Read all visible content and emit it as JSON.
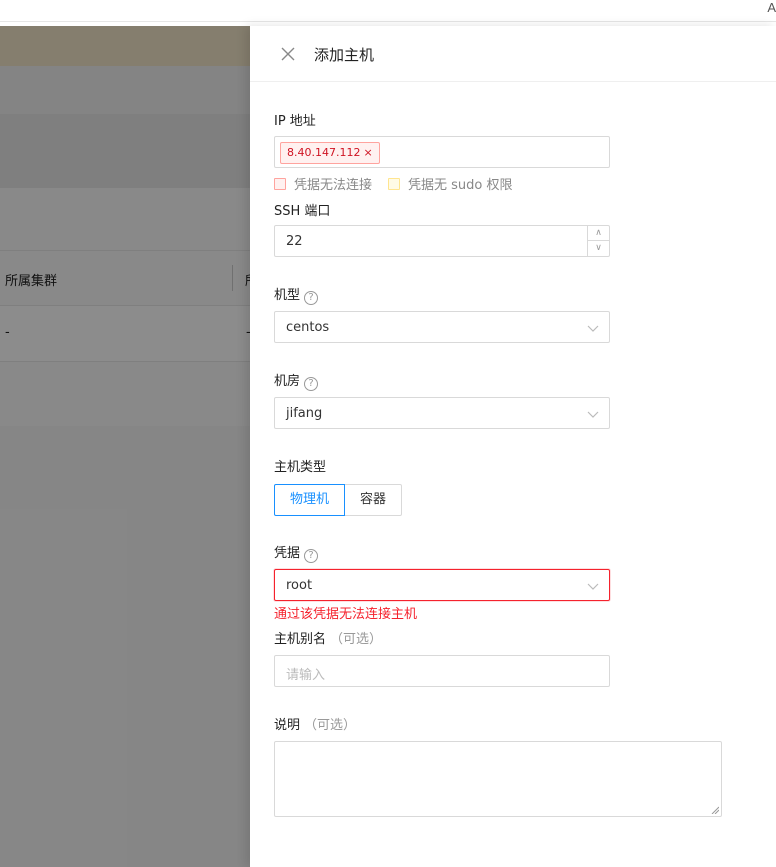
{
  "browser": {
    "corner_char": "A"
  },
  "background_page": {
    "column_header_1": "所属集群",
    "column_header_2": "所",
    "row_cell_1": "-",
    "row_cell_2": "-"
  },
  "drawer": {
    "title": "添加主机",
    "close_icon": "close-icon",
    "ip": {
      "label": "IP 地址",
      "tags": [
        "8.40.147.112"
      ],
      "tag_close": "×",
      "legend_red": "凭据无法连接",
      "legend_yellow": "凭据无 sudo 权限"
    },
    "ssh_port": {
      "label": "SSH 端口",
      "value": "22",
      "up": "∧",
      "down": "∨"
    },
    "model": {
      "label": "机型",
      "help": "?",
      "value": "centos"
    },
    "room": {
      "label": "机房",
      "help": "?",
      "value": "jifang"
    },
    "host_type": {
      "label": "主机类型",
      "options": [
        "物理机",
        "容器"
      ],
      "selected": "物理机"
    },
    "credential": {
      "label": "凭据",
      "help": "?",
      "value": "root",
      "error": "通过该凭据无法连接主机"
    },
    "alias": {
      "label": "主机别名",
      "optional": "（可选）",
      "placeholder": "请输入"
    },
    "description": {
      "label": "说明",
      "optional": "（可选）",
      "value": ""
    }
  },
  "colors": {
    "primary": "#1890ff",
    "error": "#f5222d",
    "tag_bg": "#fff1f0",
    "tag_border": "#ffa39e",
    "warn_bg": "#fffbe6"
  }
}
